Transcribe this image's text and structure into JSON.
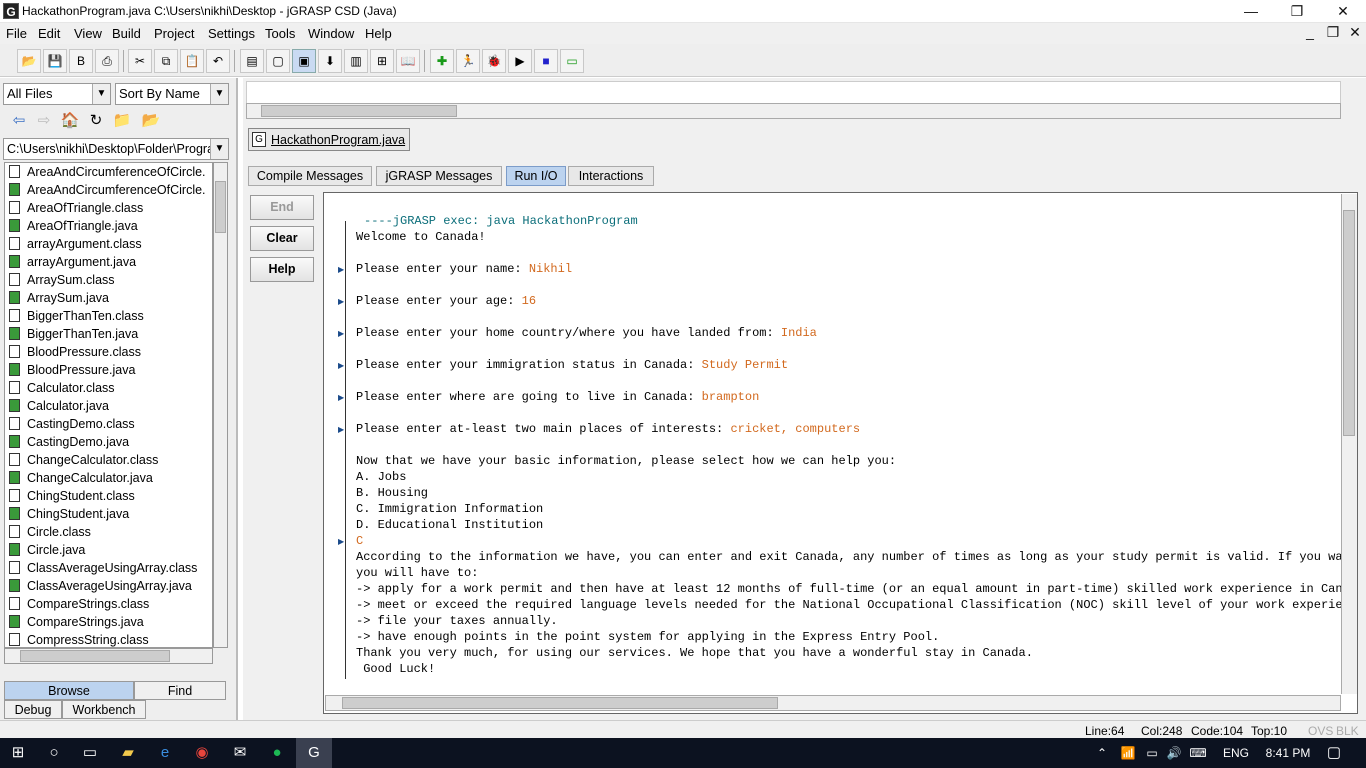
{
  "window": {
    "title": "HackathonProgram.java  C:\\Users\\nikhi\\Desktop - jGRASP CSD (Java)",
    "app_icon": "G",
    "minimize": "—",
    "restore": "❐",
    "close": "✕"
  },
  "menu": [
    "File",
    "Edit",
    "View",
    "Build",
    "Project",
    "Settings",
    "Tools",
    "Window",
    "Help"
  ],
  "browser": {
    "filter": "All Files",
    "sort": "Sort By Name",
    "path": "C:\\Users\\nikhi\\Desktop\\Folder\\Progra",
    "files": [
      {
        "name": "AreaAndCircumferenceOfCircle.",
        "type": "class"
      },
      {
        "name": "AreaAndCircumferenceOfCircle.",
        "type": "java"
      },
      {
        "name": "AreaOfTriangle.class",
        "type": "class"
      },
      {
        "name": "AreaOfTriangle.java",
        "type": "java"
      },
      {
        "name": "arrayArgument.class",
        "type": "class"
      },
      {
        "name": "arrayArgument.java",
        "type": "java"
      },
      {
        "name": "ArraySum.class",
        "type": "class"
      },
      {
        "name": "ArraySum.java",
        "type": "java"
      },
      {
        "name": "BiggerThanTen.class",
        "type": "class"
      },
      {
        "name": "BiggerThanTen.java",
        "type": "java"
      },
      {
        "name": "BloodPressure.class",
        "type": "class"
      },
      {
        "name": "BloodPressure.java",
        "type": "java"
      },
      {
        "name": "Calculator.class",
        "type": "class"
      },
      {
        "name": "Calculator.java",
        "type": "java"
      },
      {
        "name": "CastingDemo.class",
        "type": "class"
      },
      {
        "name": "CastingDemo.java",
        "type": "java"
      },
      {
        "name": "ChangeCalculator.class",
        "type": "class"
      },
      {
        "name": "ChangeCalculator.java",
        "type": "java"
      },
      {
        "name": "ChingStudent.class",
        "type": "class"
      },
      {
        "name": "ChingStudent.java",
        "type": "java"
      },
      {
        "name": "Circle.class",
        "type": "class"
      },
      {
        "name": "Circle.java",
        "type": "java"
      },
      {
        "name": "ClassAverageUsingArray.class",
        "type": "class"
      },
      {
        "name": "ClassAverageUsingArray.java",
        "type": "java"
      },
      {
        "name": "CompareStrings.class",
        "type": "class"
      },
      {
        "name": "CompareStrings.java",
        "type": "java"
      },
      {
        "name": "CompressString.class",
        "type": "class"
      }
    ],
    "tabs": {
      "browse": "Browse",
      "find": "Find",
      "debug": "Debug",
      "workbench": "Workbench"
    }
  },
  "editor": {
    "doc_tab": "HackathonProgram.java"
  },
  "message_tabs": [
    "Compile Messages",
    "jGRASP Messages",
    "Run I/O",
    "Interactions"
  ],
  "active_message_tab": "Run I/O",
  "side_buttons": {
    "end": "End",
    "clear": "Clear",
    "help": "Help"
  },
  "console": {
    "header": "----jGRASP exec: java HackathonProgram",
    "lines": [
      {
        "text": "Welcome to Canada!",
        "input": ""
      },
      {
        "text": "",
        "input": ""
      },
      {
        "text": "Please enter your name: ",
        "input": "Nikhil",
        "marker": true
      },
      {
        "text": "",
        "input": ""
      },
      {
        "text": "Please enter your age: ",
        "input": "16",
        "marker": true
      },
      {
        "text": "",
        "input": ""
      },
      {
        "text": "Please enter your home country/where you have landed from: ",
        "input": "India",
        "marker": true
      },
      {
        "text": "",
        "input": ""
      },
      {
        "text": "Please enter your immigration status in Canada: ",
        "input": "Study Permit",
        "marker": true
      },
      {
        "text": "",
        "input": ""
      },
      {
        "text": "Please enter where are going to live in Canada: ",
        "input": "brampton",
        "marker": true
      },
      {
        "text": "",
        "input": ""
      },
      {
        "text": "Please enter at-least two main places of interests: ",
        "input": "cricket, computers",
        "marker": true
      },
      {
        "text": "",
        "input": ""
      },
      {
        "text": "Now that we have your basic information, please select how we can help you:",
        "input": ""
      },
      {
        "text": "A. Jobs",
        "input": ""
      },
      {
        "text": "B. Housing",
        "input": ""
      },
      {
        "text": "C. Immigration Information",
        "input": ""
      },
      {
        "text": "D. Educational Institution",
        "input": ""
      },
      {
        "text": "",
        "input": "C",
        "marker": true
      },
      {
        "text": "According to the information we have, you can enter and exit Canada, any number of times as long as your study permit is valid. If you want",
        "input": ""
      },
      {
        "text": "you will have to:",
        "input": ""
      },
      {
        "text": "-> apply for a work permit and then have at least 12 months of full-time (or an equal amount in part-time) skilled work experience in Canada",
        "input": ""
      },
      {
        "text": "-> meet or exceed the required language levels needed for the National Occupational Classification (NOC) skill level of your work experience",
        "input": ""
      },
      {
        "text": "-> file your taxes annually.",
        "input": ""
      },
      {
        "text": "-> have enough points in the point system for applying in the Express Entry Pool.",
        "input": ""
      },
      {
        "text": "Thank you very much, for using our services. We hope that you have a wonderful stay in Canada.",
        "input": ""
      },
      {
        "text": " Good Luck!",
        "input": ""
      }
    ]
  },
  "status": {
    "line": "Line:64",
    "col": "Col:248",
    "code": "Code:104",
    "top": "Top:10",
    "ovs": "OVS",
    "blk": "BLK"
  },
  "taskbar": {
    "lang": "ENG",
    "time": "8:41 PM"
  },
  "colors": {
    "input_text": "#d2691e",
    "header_text": "#0b6e7a",
    "active_tab": "#bcd3ef",
    "taskbar": "#0c1220"
  }
}
